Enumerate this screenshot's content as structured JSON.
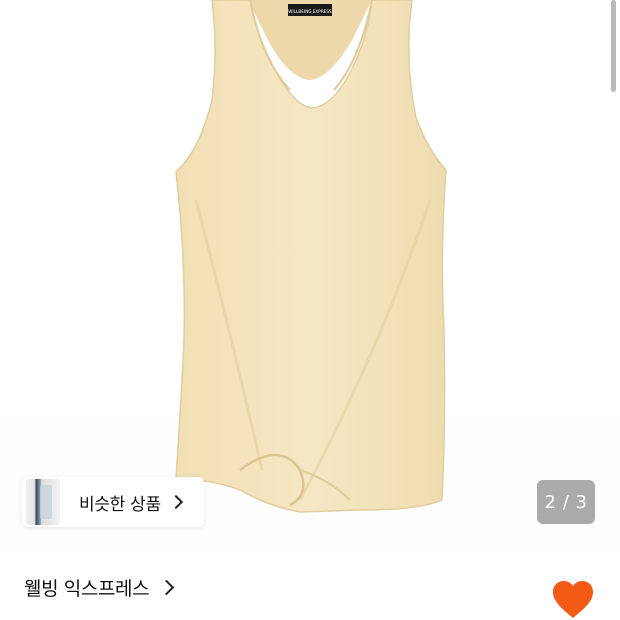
{
  "product_image": {
    "label_text": "WILLBEING EXPRESS",
    "color": "#f3e3bc"
  },
  "similar_products": {
    "label": "비슷한 상품",
    "icon": "chevron-right-icon"
  },
  "pagination": {
    "text": "2 / 3"
  },
  "seller": {
    "name": "웰빙 익스프레스",
    "icon": "chevron-right-icon"
  },
  "wishlist": {
    "icon": "heart-icon",
    "color": "#f25a16"
  }
}
